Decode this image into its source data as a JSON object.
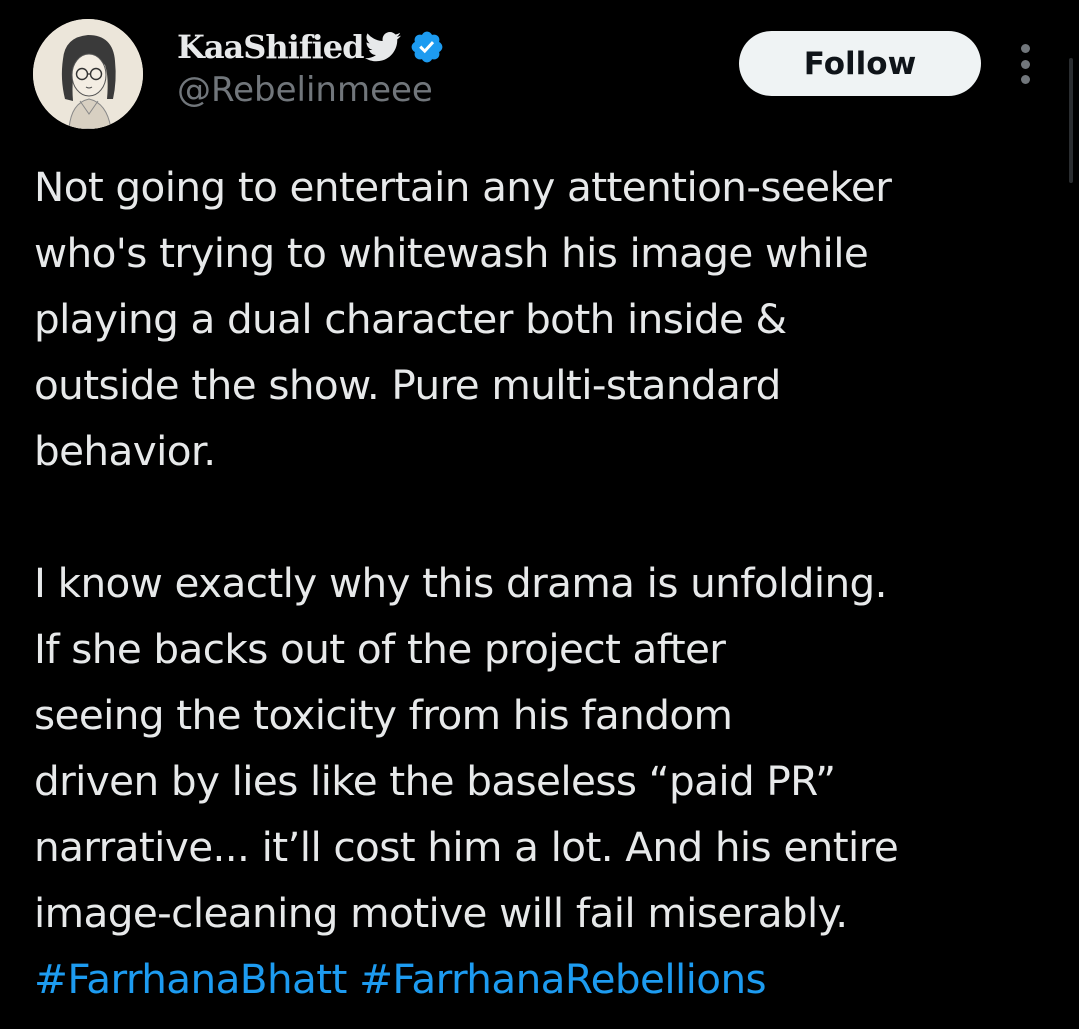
{
  "author": {
    "display_name": "KaaShified",
    "handle": "@Rebelinmeee",
    "verified": true,
    "name_emoji": "bird-icon"
  },
  "actions": {
    "follow_label": "Follow",
    "more_icon": "more-vertical-icon"
  },
  "tweet": {
    "paragraph1": [
      "Not going to entertain any attention-seeker",
      "who's trying to whitewash his image while",
      "playing a dual character both inside &",
      "outside the show. Pure multi-standard",
      "behavior."
    ],
    "paragraph2": [
      "I know exactly why this drama is unfolding.",
      "If she backs out of the project after",
      "seeing the toxicity from his fandom",
      "driven by lies like the baseless “paid PR”",
      "narrative... it’ll cost him a lot. And his entire",
      "image-cleaning motive will fail miserably."
    ],
    "hashtags": [
      "#FarrhanaBhatt",
      "#FarrhanaRebellions"
    ]
  },
  "colors": {
    "background": "#000000",
    "text": "#e7e9ea",
    "secondary_text": "#71767b",
    "link": "#1d9bf0",
    "verified_badge": "#1d9bf0",
    "follow_button_bg": "#eff3f4"
  }
}
